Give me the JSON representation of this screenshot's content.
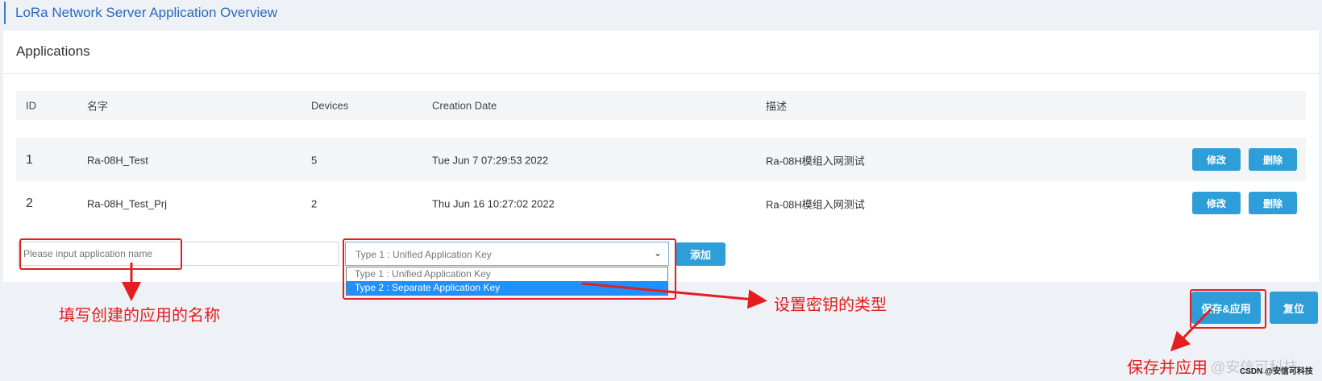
{
  "header": {
    "title": "LoRa Network Server Application Overview"
  },
  "panel": {
    "title": "Applications"
  },
  "table": {
    "columns": [
      "ID",
      "名字",
      "Devices",
      "Creation Date",
      "描述"
    ],
    "rows": [
      {
        "id": "1",
        "name": "Ra-08H_Test",
        "devices": "5",
        "date": "Tue Jun 7 07:29:53 2022",
        "desc": "Ra-08H模组入网测试",
        "edit": "修改",
        "delete": "删除"
      },
      {
        "id": "2",
        "name": "Ra-08H_Test_Prj",
        "devices": "2",
        "date": "Thu Jun 16 10:27:02 2022",
        "desc": "Ra-08H模组入网测试",
        "edit": "修改",
        "delete": "删除"
      }
    ]
  },
  "form": {
    "name_placeholder": "Please input application name",
    "type_selected": "Type 1 : Unified Application Key",
    "type_options": [
      "Type 1 : Unified Application Key",
      "Type 2 : Separate Application Key"
    ],
    "add_label": "添加"
  },
  "footer": {
    "save_label": "保存&应用",
    "reset_label": "复位"
  },
  "annotations": {
    "name_hint": "填写创建的应用的名称",
    "type_hint": "设置密钥的类型",
    "save_hint": "保存并应用"
  },
  "watermark": {
    "main": "@安信可科技",
    "small": "CSDN @安信可科技"
  },
  "colors": {
    "accent": "#2e9ed8",
    "annotation": "#e41e1e",
    "title": "#2a6ac0",
    "dropdown_highlight": "#1e90ff"
  }
}
